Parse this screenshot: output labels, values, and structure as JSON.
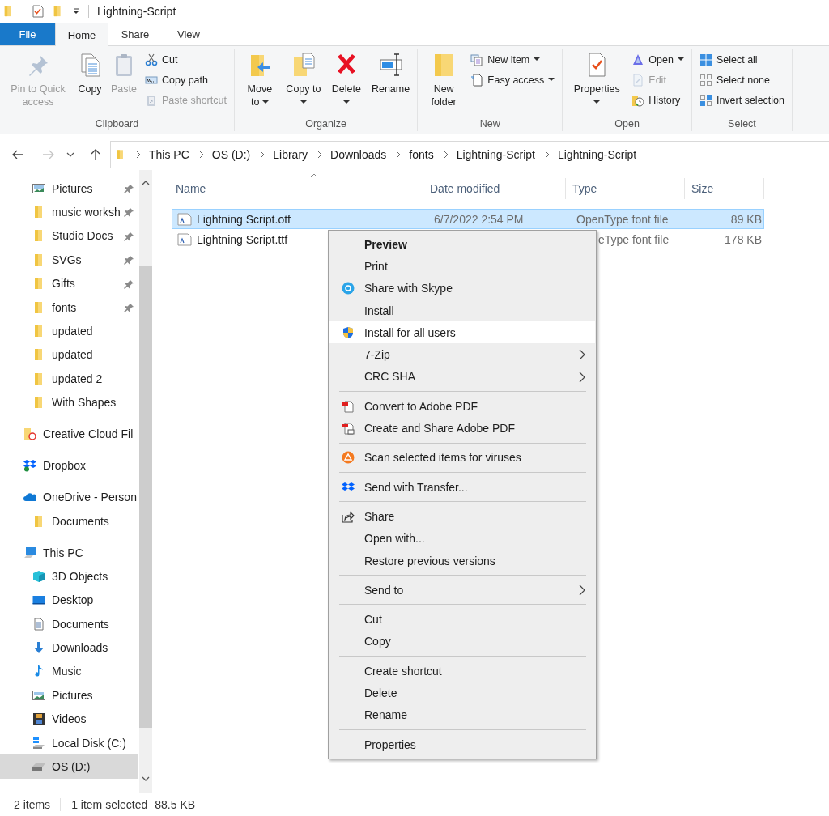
{
  "window": {
    "title": "Lightning-Script"
  },
  "ribbon_tabs": [
    {
      "label": "File",
      "kind": "file",
      "selected": false
    },
    {
      "label": "Home",
      "kind": "tab",
      "selected": true
    },
    {
      "label": "Share",
      "kind": "tab",
      "selected": false
    },
    {
      "label": "View",
      "kind": "tab",
      "selected": false
    }
  ],
  "ribbon": {
    "groups": [
      {
        "label": "Clipboard",
        "buttons": [
          {
            "label": "Pin to Quick access",
            "kind": "large",
            "disabled": true,
            "dropdown": false
          },
          {
            "label": "Copy",
            "kind": "large",
            "disabled": false,
            "dropdown": false
          },
          {
            "label": "Paste",
            "kind": "large",
            "disabled": true,
            "dropdown": false
          },
          {
            "label": "Cut",
            "kind": "small",
            "disabled": false,
            "dropdown": false
          },
          {
            "label": "Copy path",
            "kind": "small",
            "disabled": false,
            "dropdown": false
          },
          {
            "label": "Paste shortcut",
            "kind": "small",
            "disabled": true,
            "dropdown": false
          }
        ]
      },
      {
        "label": "Organize",
        "buttons": [
          {
            "label": "Move to",
            "kind": "large",
            "disabled": false,
            "dropdown": true
          },
          {
            "label": "Copy to",
            "kind": "large",
            "disabled": false,
            "dropdown": true
          },
          {
            "label": "Delete",
            "kind": "large",
            "disabled": false,
            "dropdown": true
          },
          {
            "label": "Rename",
            "kind": "large",
            "disabled": false,
            "dropdown": false
          }
        ]
      },
      {
        "label": "New",
        "buttons": [
          {
            "label": "New folder",
            "kind": "large",
            "disabled": false,
            "dropdown": false
          },
          {
            "label": "New item",
            "kind": "small",
            "disabled": false,
            "dropdown": true
          },
          {
            "label": "Easy access",
            "kind": "small",
            "disabled": false,
            "dropdown": true
          }
        ]
      },
      {
        "label": "Open",
        "buttons": [
          {
            "label": "Properties",
            "kind": "large",
            "disabled": false,
            "dropdown": true
          },
          {
            "label": "Open",
            "kind": "small",
            "disabled": false,
            "dropdown": true
          },
          {
            "label": "Edit",
            "kind": "small",
            "disabled": true,
            "dropdown": false
          },
          {
            "label": "History",
            "kind": "small",
            "disabled": false,
            "dropdown": false
          }
        ]
      },
      {
        "label": "Select",
        "buttons": [
          {
            "label": "Select all",
            "kind": "small",
            "disabled": false,
            "dropdown": false
          },
          {
            "label": "Select none",
            "kind": "small",
            "disabled": false,
            "dropdown": false
          },
          {
            "label": "Invert selection",
            "kind": "small",
            "disabled": false,
            "dropdown": false
          }
        ]
      }
    ]
  },
  "navigation": {
    "back": {
      "disabled": false
    },
    "forward": {
      "disabled": true
    }
  },
  "address_bar": {
    "path": [
      "This PC",
      "OS (D:)",
      "Library",
      "Downloads",
      "fonts",
      "Lightning-Script",
      "Lightning-Script"
    ]
  },
  "sidebar": {
    "quick_access": [
      {
        "label": "Pictures",
        "kind": "pictures",
        "pinned": true,
        "selected": false
      },
      {
        "label": "music worksh",
        "kind": "folder",
        "pinned": true,
        "selected": false
      },
      {
        "label": "Studio Docs",
        "kind": "folder",
        "pinned": true,
        "selected": false
      },
      {
        "label": "SVGs",
        "kind": "folder",
        "pinned": true,
        "selected": false
      },
      {
        "label": "Gifts",
        "kind": "folder",
        "pinned": true,
        "selected": false
      },
      {
        "label": "fonts",
        "kind": "folder",
        "pinned": true,
        "selected": false
      },
      {
        "label": "updated",
        "kind": "folder",
        "pinned": false,
        "selected": false
      },
      {
        "label": "updated",
        "kind": "folder",
        "pinned": false,
        "selected": false
      },
      {
        "label": "updated 2",
        "kind": "folder",
        "pinned": false,
        "selected": false
      },
      {
        "label": "With Shapes",
        "kind": "folder",
        "pinned": false,
        "selected": false
      }
    ],
    "locations": [
      {
        "label": "Creative Cloud Fil",
        "kind": "creative",
        "selected": false
      },
      {
        "label": "Dropbox",
        "kind": "dropbox",
        "selected": false
      },
      {
        "label": "OneDrive - Person",
        "kind": "onedrive",
        "selected": false,
        "children": [
          {
            "label": "Documents",
            "kind": "folder",
            "selected": false
          }
        ]
      },
      {
        "label": "This PC",
        "kind": "pc",
        "selected": false,
        "children": [
          {
            "label": "3D Objects",
            "kind": "objects3d",
            "selected": false
          },
          {
            "label": "Desktop",
            "kind": "desktop",
            "selected": false
          },
          {
            "label": "Documents",
            "kind": "documents",
            "selected": false
          },
          {
            "label": "Downloads",
            "kind": "downloads",
            "selected": false
          },
          {
            "label": "Music",
            "kind": "music",
            "selected": false
          },
          {
            "label": "Pictures",
            "kind": "pictures",
            "selected": false
          },
          {
            "label": "Videos",
            "kind": "videos",
            "selected": false
          },
          {
            "label": "Local Disk (C:)",
            "kind": "disk",
            "selected": false
          },
          {
            "label": "OS (D:)",
            "kind": "drive",
            "selected": true
          }
        ]
      }
    ]
  },
  "file_list": {
    "columns": [
      "Name",
      "Date modified",
      "Type",
      "Size"
    ],
    "rows": [
      {
        "name": "Lightning Script.otf",
        "date_modified": "6/7/2022 2:54 PM",
        "type": "OpenType font file",
        "type_cut": false,
        "size": "89 KB",
        "selected": true
      },
      {
        "name": "Lightning Script.ttf",
        "type": "eType font file",
        "type_cut": true,
        "size": "178 KB",
        "selected": false
      }
    ]
  },
  "context_menu": {
    "sections": [
      [
        {
          "label": "Preview",
          "kind": "plain",
          "default": true,
          "submenu": false,
          "selected": false
        },
        {
          "label": "Print",
          "kind": "plain",
          "default": false,
          "submenu": false,
          "selected": false
        },
        {
          "label": "Share with Skype",
          "kind": "skype",
          "default": false,
          "submenu": false,
          "selected": false
        },
        {
          "label": "Install",
          "kind": "plain",
          "default": false,
          "submenu": false,
          "selected": false
        },
        {
          "label": "Install for all users",
          "kind": "shield",
          "default": false,
          "submenu": false,
          "selected": true
        },
        {
          "label": "7-Zip",
          "kind": "plain",
          "default": false,
          "submenu": true,
          "selected": false
        },
        {
          "label": "CRC SHA",
          "kind": "plain",
          "default": false,
          "submenu": true,
          "selected": false
        }
      ],
      [
        {
          "label": "Convert to Adobe PDF",
          "kind": "pdf",
          "default": false,
          "submenu": false,
          "selected": false
        },
        {
          "label": "Create and Share Adobe PDF",
          "kind": "pdfshare",
          "default": false,
          "submenu": false,
          "selected": false
        }
      ],
      [
        {
          "label": "Scan selected items for viruses",
          "kind": "scan",
          "default": false,
          "submenu": false,
          "selected": false
        }
      ],
      [
        {
          "label": "Send with Transfer...",
          "kind": "transfer",
          "default": false,
          "submenu": false,
          "selected": false
        }
      ],
      [
        {
          "label": "Share",
          "kind": "share",
          "default": false,
          "submenu": false,
          "selected": false
        },
        {
          "label": "Open with...",
          "kind": "plain",
          "default": false,
          "submenu": false,
          "selected": false
        },
        {
          "label": "Restore previous versions",
          "kind": "plain",
          "default": false,
          "submenu": false,
          "selected": false
        }
      ],
      [
        {
          "label": "Send to",
          "kind": "plain",
          "default": false,
          "submenu": true,
          "selected": false
        }
      ],
      [
        {
          "label": "Cut",
          "kind": "plain",
          "default": false,
          "submenu": false,
          "selected": false
        },
        {
          "label": "Copy",
          "kind": "plain",
          "default": false,
          "submenu": false,
          "selected": false
        }
      ],
      [
        {
          "label": "Create shortcut",
          "kind": "plain",
          "default": false,
          "submenu": false,
          "selected": false
        },
        {
          "label": "Delete",
          "kind": "plain",
          "default": false,
          "submenu": false,
          "selected": false
        },
        {
          "label": "Rename",
          "kind": "plain",
          "default": false,
          "submenu": false,
          "selected": false
        }
      ],
      [
        {
          "label": "Properties",
          "kind": "plain",
          "default": false,
          "submenu": false,
          "selected": false
        }
      ]
    ]
  },
  "status_bar": {
    "item_count": "2 items",
    "selection": "1 item selected",
    "selection_size": "88.5 KB"
  }
}
